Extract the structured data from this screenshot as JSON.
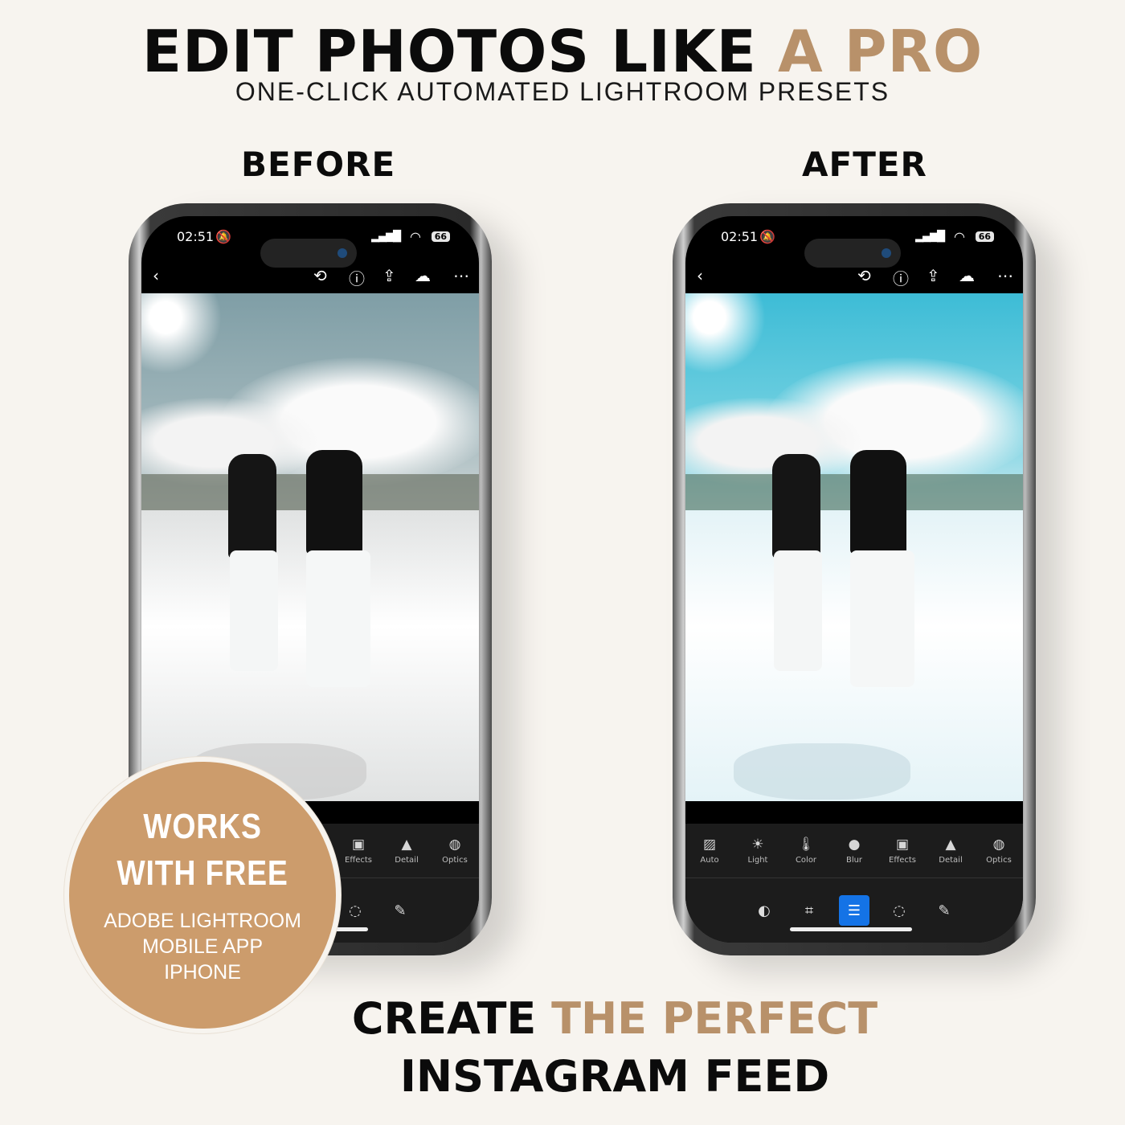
{
  "header": {
    "title_main": "EDIT PHOTOS LIKE ",
    "title_accent": "A PRO",
    "subtitle": "ONE-CLICK AUTOMATED LIGHTROOM PRESETS"
  },
  "labels": {
    "before": "BEFORE",
    "after": "AFTER"
  },
  "colors": {
    "accent": "#b8916a",
    "badge": "#cc9c6c",
    "active_tool": "#1473e6",
    "background": "#f7f4ef"
  },
  "phone": {
    "time": "02:51",
    "battery": "66",
    "icons": [
      "back-icon",
      "history-icon",
      "help-icon",
      "share-icon",
      "cloud-sync-icon",
      "more-icon"
    ],
    "tools": [
      {
        "label": "Auto",
        "icon": "auto-icon"
      },
      {
        "label": "Light",
        "icon": "sun-icon"
      },
      {
        "label": "Color",
        "icon": "thermometer-icon"
      },
      {
        "label": "Blur",
        "icon": "drop-icon"
      },
      {
        "label": "Effects",
        "icon": "vignette-icon"
      },
      {
        "label": "Detail",
        "icon": "triangle-icon"
      },
      {
        "label": "Optics",
        "icon": "lens-icon"
      }
    ],
    "modes": [
      "presets-icon",
      "crop-icon",
      "edit-sliders-icon",
      "masking-icon",
      "healing-icon"
    ],
    "active_mode": "edit-sliders-icon"
  },
  "badge": {
    "line1": "WORKS",
    "line2": "WITH FREE",
    "line3": "ADOBE LIGHTROOM",
    "line4": "MOBILE APP",
    "line5": "IPHONE"
  },
  "footer": {
    "line1_main": "CREATE ",
    "line1_accent": "THE PERFECT",
    "line2": "INSTAGRAM FEED"
  }
}
